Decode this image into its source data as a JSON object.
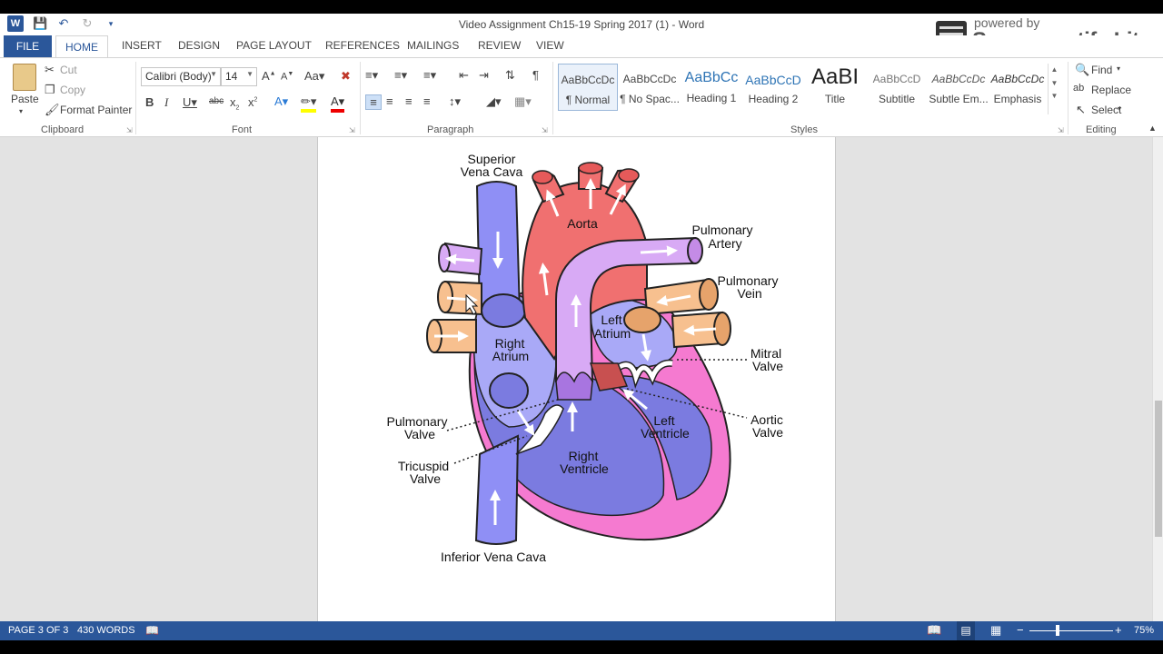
{
  "window": {
    "title": "Video Assignment Ch15-19 Spring 2017 (1) - Word"
  },
  "watermark": {
    "small": "powered by",
    "big": "Screencastify Lite"
  },
  "tabs": [
    {
      "label": "FILE"
    },
    {
      "label": "HOME"
    },
    {
      "label": "INSERT"
    },
    {
      "label": "DESIGN"
    },
    {
      "label": "PAGE LAYOUT"
    },
    {
      "label": "REFERENCES"
    },
    {
      "label": "MAILINGS"
    },
    {
      "label": "REVIEW"
    },
    {
      "label": "VIEW"
    }
  ],
  "ribbon": {
    "clipboard": {
      "paste": "Paste",
      "cut": "Cut",
      "copy": "Copy",
      "format_painter": "Format Painter",
      "group": "Clipboard"
    },
    "font": {
      "name": "Calibri (Body)",
      "size": "14",
      "group": "Font"
    },
    "paragraph": {
      "group": "Paragraph"
    },
    "styles": {
      "group": "Styles",
      "items": [
        {
          "preview": "AaBbCcDc",
          "name": "¶ Normal"
        },
        {
          "preview": "AaBbCcDc",
          "name": "¶ No Spac..."
        },
        {
          "preview": "AaBbCc",
          "name": "Heading 1"
        },
        {
          "preview": "AaBbCcD",
          "name": "Heading 2"
        },
        {
          "preview": "AaBI",
          "name": "Title"
        },
        {
          "preview": "AaBbCcD",
          "name": "Subtitle"
        },
        {
          "preview": "AaBbCcDc",
          "name": "Subtle Em..."
        },
        {
          "preview": "AaBbCcDc",
          "name": "Emphasis"
        }
      ]
    },
    "editing": {
      "find": "Find",
      "replace": "Replace",
      "select": "Select",
      "group": "Editing"
    }
  },
  "diagram": {
    "labels": {
      "superior_vena_cava_1": "Superior",
      "superior_vena_cava_2": "Vena Cava",
      "aorta": "Aorta",
      "pulmonary_artery_1": "Pulmonary",
      "pulmonary_artery_2": "Artery",
      "pulmonary_vein_1": "Pulmonary",
      "pulmonary_vein_2": "Vein",
      "left_atrium_1": "Left",
      "left_atrium_2": "Atrium",
      "mitral_valve_1": "Mitral",
      "mitral_valve_2": "Valve",
      "right_atrium_1": "Right",
      "right_atrium_2": "Atrium",
      "aortic_valve_1": "Aortic",
      "aortic_valve_2": "Valve",
      "left_ventricle_1": "Left",
      "left_ventricle_2": "Ventricle",
      "pulmonary_valve_1": "Pulmonary",
      "pulmonary_valve_2": "Valve",
      "right_ventricle_1": "Right",
      "right_ventricle_2": "Ventricle",
      "tricuspid_valve_1": "Tricuspid",
      "tricuspid_valve_2": "Valve",
      "inferior_vena_cava": "Inferior Vena Cava"
    }
  },
  "status": {
    "page": "PAGE 3 OF 3",
    "words": "430 WORDS",
    "zoom": "75%"
  },
  "colors": {
    "brand": "#2b579a",
    "vein_blue": "#8f8ff5",
    "aorta_red": "#f07070",
    "pulmonary_purple": "#d8aaf5",
    "pulmonary_vein_tan": "#f7c08f",
    "heart_pink": "#f57ad0"
  }
}
